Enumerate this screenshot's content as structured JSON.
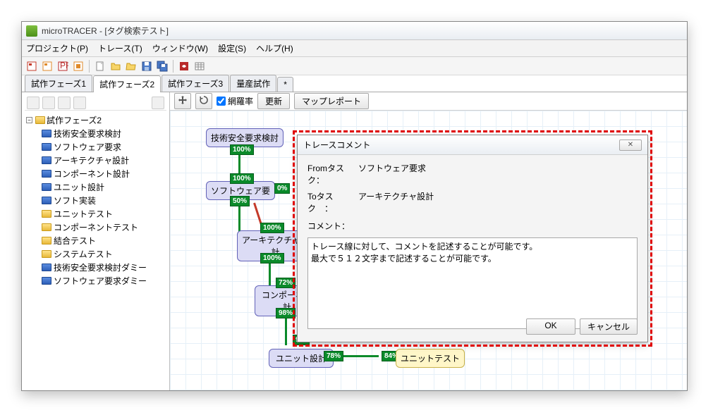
{
  "title": "microTRACER - [タグ検索テスト]",
  "menu": {
    "project": "プロジェクト(P)",
    "trace": "トレース(T)",
    "window": "ウィンドウ(W)",
    "settings": "設定(S)",
    "help": "ヘルプ(H)"
  },
  "tabs": [
    "試作フェーズ1",
    "試作フェーズ2",
    "試作フェーズ3",
    "量産試作",
    "*"
  ],
  "active_tab": 1,
  "sidebar": {
    "root": "試作フェーズ2",
    "items": [
      {
        "label": "技術安全要求検討",
        "color": "blue"
      },
      {
        "label": "ソフトウェア要求",
        "color": "blue"
      },
      {
        "label": "アーキテクチャ設計",
        "color": "blue"
      },
      {
        "label": "コンポーネント設計",
        "color": "blue"
      },
      {
        "label": "ユニット設計",
        "color": "blue"
      },
      {
        "label": "ソフト実装",
        "color": "blue"
      },
      {
        "label": "ユニットテスト",
        "color": "yellow"
      },
      {
        "label": "コンポーネントテスト",
        "color": "yellow"
      },
      {
        "label": "結合テスト",
        "color": "yellow"
      },
      {
        "label": "システムテスト",
        "color": "yellow"
      },
      {
        "label": "技術安全要求検討ダミー",
        "color": "blue"
      },
      {
        "label": "ソフトウェア要求ダミー",
        "color": "blue"
      }
    ]
  },
  "canvas_toolbar": {
    "coverage_label": "網羅率",
    "update": "更新",
    "map_report": "マップレポート"
  },
  "nodes": {
    "n1": "技術安全要求検討",
    "n2": "ソフトウェア要",
    "n3": "アーキテクチャ設\n計",
    "n4": "コンポーネン\n計",
    "n5": "ユニット設計",
    "n6": "ユニットテスト"
  },
  "pcts": {
    "p1": "100%",
    "p2": "100%",
    "p2b": "0%",
    "p3": "50%",
    "p4": "100%",
    "p5": "100%",
    "p6": "72%",
    "p7": "98%",
    "p8": "78%",
    "p9": "84%"
  },
  "dialog": {
    "title": "トレースコメント",
    "from_label": "Fromタスク：",
    "from_value": "ソフトウェア要求",
    "to_label": "Toタスク　：",
    "to_value": "アーキテクチャ設計",
    "comment_label": "コメント：",
    "comment_text": "トレース線に対して、コメントを記述することが可能です。\n最大で５１２文字まで記述することが可能です。",
    "ok": "OK",
    "cancel": "キャンセル"
  }
}
